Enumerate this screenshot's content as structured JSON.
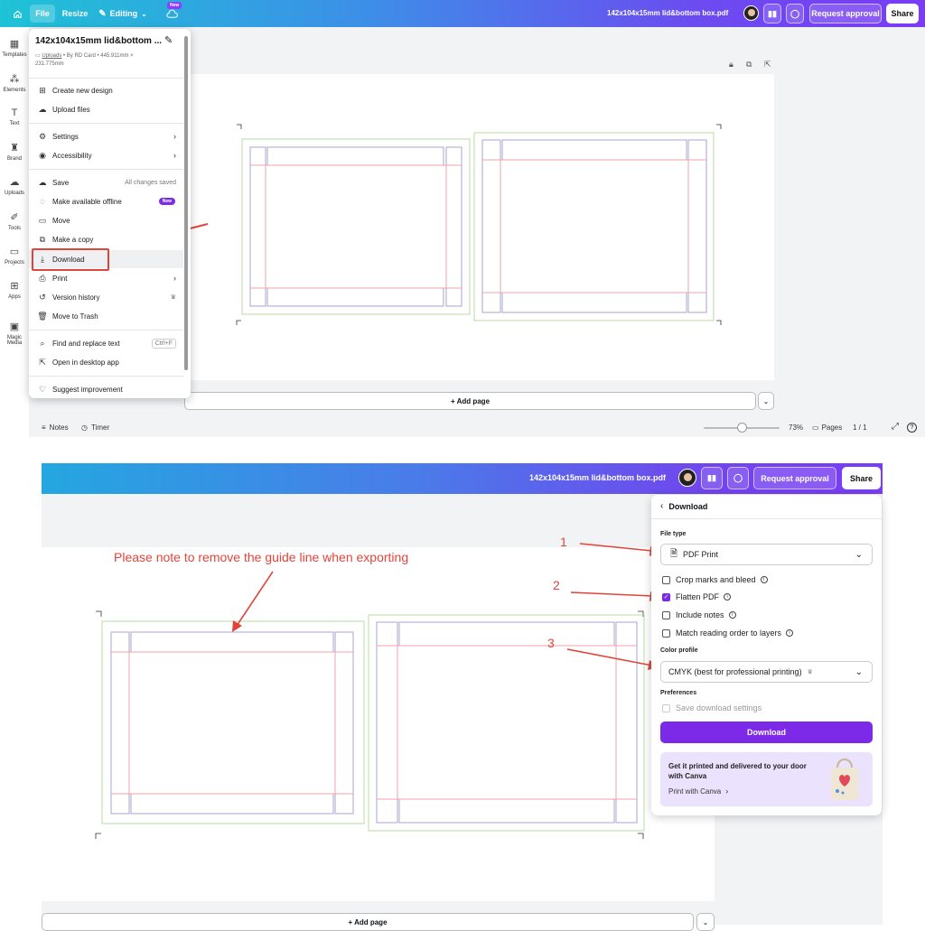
{
  "top": {
    "file_label": "File",
    "resize_label": "Resize",
    "editing_label": "Editing",
    "new_badge": "New",
    "doc_title": "142x104x15mm lid&bottom box.pdf",
    "request_approval": "Request approval",
    "share": "Share"
  },
  "sidebar": {
    "items": [
      {
        "label": "Templates"
      },
      {
        "label": "Elements"
      },
      {
        "label": "Text"
      },
      {
        "label": "Brand"
      },
      {
        "label": "Uploads"
      },
      {
        "label": "Tools"
      },
      {
        "label": "Projects"
      },
      {
        "label": "Apps"
      },
      {
        "label": "Magic Media"
      }
    ]
  },
  "menu": {
    "title": "142x104x15mm lid&bottom ...",
    "meta_link": "Uploads",
    "meta_rest": " • By RD Card • 445.911mm ×",
    "meta_line2": "231.775mm",
    "items": [
      {
        "label": "Create new design"
      },
      {
        "label": "Upload files"
      },
      {
        "label": "Settings"
      },
      {
        "label": "Accessibility"
      },
      {
        "label": "Save",
        "right": "All changes saved"
      },
      {
        "label": "Make available offline",
        "badge": "New"
      },
      {
        "label": "Move"
      },
      {
        "label": "Make a copy"
      },
      {
        "label": "Download"
      },
      {
        "label": "Print"
      },
      {
        "label": "Version history"
      },
      {
        "label": "Move to Trash"
      },
      {
        "label": "Find and replace text",
        "shortcut": "Ctrl+F"
      },
      {
        "label": "Open in desktop app"
      },
      {
        "label": "Suggest improvement"
      }
    ]
  },
  "canvas": {
    "add_page": "+ Add page"
  },
  "footer": {
    "notes": "Notes",
    "timer": "Timer",
    "zoom": "73%",
    "pages_label": "Pages",
    "page_count": "1 / 1"
  },
  "annotation": {
    "note": "Please note to remove the guide line when exporting",
    "n1": "1",
    "n2": "2",
    "n3": "3"
  },
  "download_panel": {
    "title": "Download",
    "file_type_label": "File type",
    "file_type_value": "PDF Print",
    "options": [
      {
        "label": "Crop marks and bleed",
        "checked": false
      },
      {
        "label": "Flatten PDF",
        "checked": true
      },
      {
        "label": "Include notes",
        "checked": false
      },
      {
        "label": "Match reading order to layers",
        "checked": false
      }
    ],
    "color_profile_label": "Color profile",
    "color_profile_value": "CMYK (best for professional printing)",
    "preferences_label": "Preferences",
    "save_settings": "Save download settings",
    "download_button": "Download",
    "promo_title": "Get it printed and delivered to your door with Canva",
    "promo_link": "Print with Canva"
  },
  "colors": {
    "accent": "#7d2ae8",
    "annotation": "#e0453c",
    "guide_green": "#b9dea0",
    "fold_pink": "#f2a3a9",
    "cut_purple": "#a9a6cf"
  }
}
